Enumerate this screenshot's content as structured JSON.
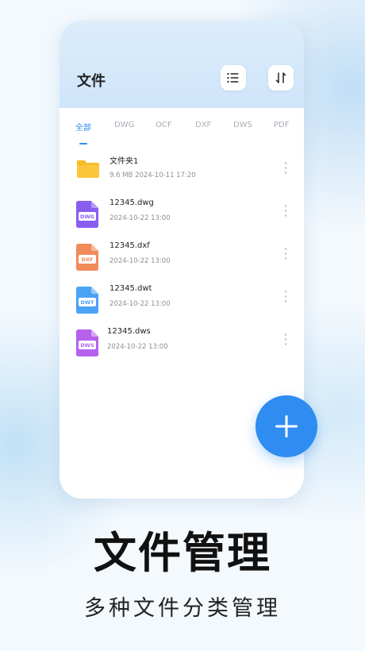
{
  "header": {
    "title": "文件"
  },
  "icons": {
    "list": "list-icon",
    "sort": "sort-icon",
    "fab": "plus-icon"
  },
  "tabs": [
    {
      "label": "全部",
      "active": true
    },
    {
      "label": "DWG",
      "active": false
    },
    {
      "label": "OCF",
      "active": false
    },
    {
      "label": "DXF",
      "active": false
    },
    {
      "label": "DWS",
      "active": false
    },
    {
      "label": "PDF",
      "active": false
    }
  ],
  "files": [
    {
      "name": "文件夹1",
      "meta": "9.6 MB    2024-10-11  17:20",
      "type": "folder",
      "color": "#f7bb2a"
    },
    {
      "name": "12345.dwg",
      "meta": "2024-10-22  13:00",
      "type": "DWG",
      "color": "#8a5cf0"
    },
    {
      "name": "12345.dxf",
      "meta": "2024-10-22  13:00",
      "type": "DXF",
      "color": "#f28a5a"
    },
    {
      "name": "12345.dwt",
      "meta": "2024-10-22  13:00",
      "type": "DWT",
      "color": "#4aa3f5"
    },
    {
      "name": "12345.dws",
      "meta": "2024-10-22  13:00",
      "type": "DWS",
      "color": "#b462ec"
    }
  ],
  "promo": {
    "title": "文件管理",
    "subtitle": "多种文件分类管理"
  },
  "colors": {
    "accent": "#2f8cf0",
    "header_bg": "#d6eafb"
  }
}
